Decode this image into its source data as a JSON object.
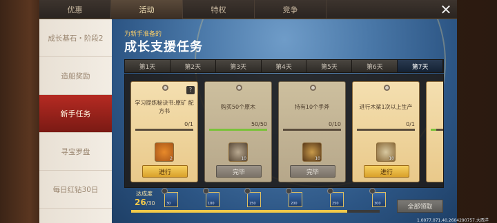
{
  "top_tabs": [
    "优惠",
    "活动",
    "特权",
    "竞争"
  ],
  "sidebar": [
    "成长基石・阶段2",
    "造船奖励",
    "新手任务",
    "寻宝罗盘",
    "每日红钻30日"
  ],
  "header": {
    "subtitle": "为新手准备的",
    "title": "成长支援任务"
  },
  "days": [
    "第1天",
    "第2天",
    "第3天",
    "第4天",
    "第5天",
    "第6天",
    "第7天"
  ],
  "cards": [
    {
      "task": "学习提炼秘诀书:原矿 配方书",
      "progress": "0/1",
      "fill": 0,
      "reward_count": "2",
      "action": "进行",
      "help": "?"
    },
    {
      "task": "购买50个原木",
      "progress": "50/50",
      "fill": 1,
      "reward_count": "10",
      "action": "完毕"
    },
    {
      "task": "持有10个手斧",
      "progress": "0/10",
      "fill": 0,
      "reward_count": "10",
      "action": "完毕"
    },
    {
      "task": "进行木桨1次以上生产",
      "progress": "0/1",
      "fill": 0,
      "reward_count": "10",
      "action": "进行"
    }
  ],
  "achievement": {
    "label": "达成度",
    "value": "26",
    "max": "/30",
    "fraction": 0.87
  },
  "chests": [
    "30",
    "100",
    "150",
    "200",
    "250",
    "300"
  ],
  "claim_all": "全部领取",
  "version": "1.0077.071.40.2604290757.大西洋",
  "colors": {
    "accent_gold": "#f2c94a",
    "active_red": "#b52a22",
    "bar_green": "#7ac23a"
  }
}
